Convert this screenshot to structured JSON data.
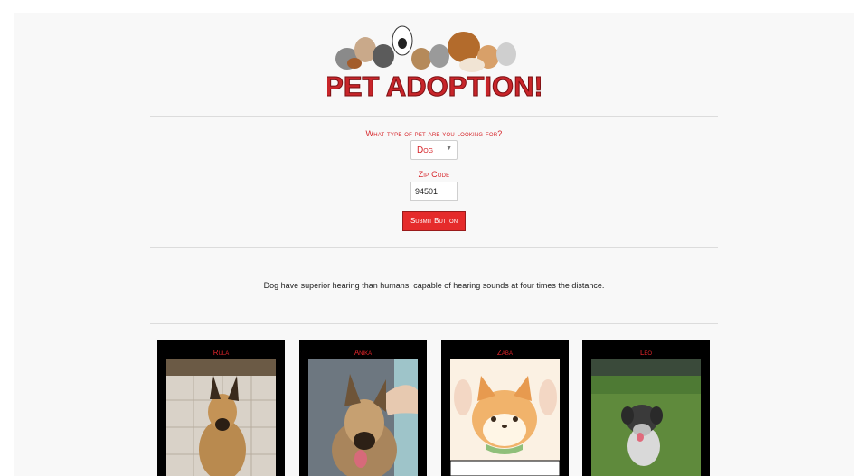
{
  "logo": {
    "text": "PET ADOPTION!"
  },
  "form": {
    "pet_type_label": "What type of pet are you looking for?",
    "pet_type_value": "Dog",
    "zip_label": "Zip Code",
    "zip_value": "94501",
    "submit_label": "Submit Button"
  },
  "fact": "Dog have superior hearing than humans, capable of hearing sounds at four times the distance.",
  "pets": [
    {
      "name": "Rula"
    },
    {
      "name": "Anika"
    },
    {
      "name": "Zaba"
    },
    {
      "name": "Leo"
    }
  ],
  "colors": {
    "accent": "#d6262b",
    "button": "#e52b2b",
    "card_bg": "#000000"
  }
}
